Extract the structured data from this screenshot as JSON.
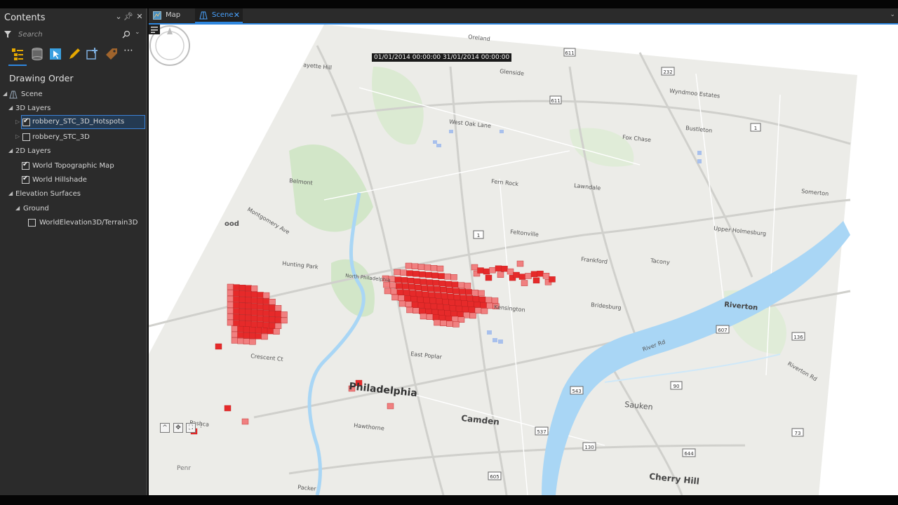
{
  "pane": {
    "title": "Contents",
    "search_placeholder": "Search",
    "drawing_order_label": "Drawing Order",
    "toolbar": [
      {
        "icon": "list-by-drawing-order-icon"
      },
      {
        "icon": "list-by-source-icon"
      },
      {
        "icon": "list-by-selection-icon"
      },
      {
        "icon": "list-by-editing-icon"
      },
      {
        "icon": "list-by-snapping-icon"
      },
      {
        "icon": "list-by-labeling-icon"
      },
      {
        "icon": "more-options-icon"
      }
    ],
    "tree": {
      "scene": "Scene",
      "layers_3d": "3D Layers",
      "hotspots": "robbery_STC_3D_Hotspots",
      "stc3d": "robbery_STC_3D",
      "layers_2d": "2D Layers",
      "topo": "World Topographic Map",
      "hillshade": "World Hillshade",
      "elev": "Elevation Surfaces",
      "ground": "Ground",
      "terrain": "WorldElevation3D/Terrain3D"
    },
    "checked": {
      "hotspots": true,
      "stc3d": false,
      "topo": true,
      "hillshade": true,
      "terrain": false
    }
  },
  "tabs": [
    {
      "label": "Map",
      "icon": "map-icon",
      "active": false
    },
    {
      "label": "Scene",
      "icon": "scene-icon",
      "active": true
    }
  ],
  "time_extent": {
    "start": "01/01/2014 00:00:00",
    "end": "31/01/2014 00:00:00"
  },
  "map_labels": {
    "philadelphia": "Philadelphia",
    "camden": "Camden",
    "pennsauken": "Sauken",
    "cherry_hill": "Cherry Hill",
    "riverton": "Riverton",
    "kensington": "Kensington",
    "bridesburg": "Bridesburg",
    "frankford": "Frankford",
    "lawndale": "Lawndale",
    "fern_rock": "Fern Rock",
    "east_poplar": "East Poplar",
    "hawthorne": "Hawthorne",
    "fox_chase": "Fox Chase",
    "bustleton": "Bustleton",
    "glenside": "Glenside",
    "oreland": "Oreland",
    "west_oak_lane": "West Oak Lane",
    "feltonville": "Feltonville",
    "lafayette_hill": "ayette Hill",
    "somerton": "Somerton",
    "wyndmoor": "Wyndmoo Estates",
    "holmesburg": "Upper Holmesburg",
    "belmont": "Belmont",
    "montgomery": "Montgomery Ave",
    "wood": "ood",
    "tacony": "Tacony",
    "river_rd": "River Rd",
    "riverton_rd": "Riverton Rd",
    "crescent": "Crescent Ct",
    "hunting_park": "Hunting Park",
    "north_philly": "North Philadelphia",
    "camden_co": "Pashca",
    "packer": "Packer",
    "shield_611": "611",
    "shield_1": "1",
    "shield_232": "232",
    "shield_73": "73",
    "shield_537": "537",
    "shield_543": "543",
    "shield_130": "130",
    "shield_605": "605",
    "shield_644": "644",
    "shield_90": "90",
    "shield_607": "607",
    "shield_136": "136"
  },
  "compass_label": "Penr",
  "colors": {
    "hotspot": "#e62a2a",
    "hotspot_light": "#f08080",
    "water": "#a9d6f5",
    "park": "#cde6c4",
    "land": "#eeeeea",
    "road": "#ffffff",
    "accent": "#2e86de"
  }
}
